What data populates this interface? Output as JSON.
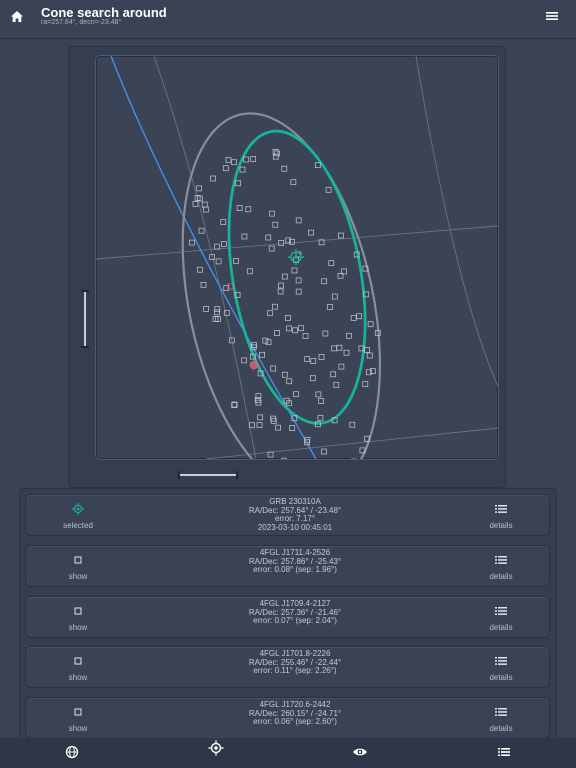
{
  "header": {
    "title": "Cone search around",
    "subtitle": "ra=257.64°, decn=-23.48°"
  },
  "colors": {
    "accent": "#16b39a",
    "selection_marker": "#e0667a",
    "galactic_line": "#4a8de0"
  },
  "sources": [
    {
      "action_icon": "target-icon",
      "action_label": "selected",
      "name": "GRB 230310A",
      "radec": "RA/Dec: 257.64° / -23.48°",
      "error": "error: 7.17°",
      "extra": "2023-03-10 00:45:01",
      "details_label": "details"
    },
    {
      "action_icon": "square-icon",
      "action_label": "show",
      "name": "4FGL J1711.4-2526",
      "radec": "RA/Dec: 257.86° / -25.43°",
      "error": "error: 0.08° (sep: 1.96°)",
      "extra": "",
      "details_label": "details"
    },
    {
      "action_icon": "square-icon",
      "action_label": "show",
      "name": "4FGL J1709.4-2127",
      "radec": "RA/Dec: 257.36° / -21.46°",
      "error": "error: 0.07° (sep: 2.04°)",
      "extra": "",
      "details_label": "details"
    },
    {
      "action_icon": "square-icon",
      "action_label": "show",
      "name": "4FGL J1701.8-2226",
      "radec": "RA/Dec: 255.46° / -22.44°",
      "error": "error: 0.11° (sep: 2.26°)",
      "extra": "",
      "details_label": "details"
    },
    {
      "action_icon": "square-icon",
      "action_label": "show",
      "name": "4FGL J1720.6-2442",
      "radec": "RA/Dec: 260.15° / -24.71°",
      "error": "error: 0.06° (sep: 2.60°)",
      "extra": "",
      "details_label": "details"
    }
  ],
  "bottom_nav": [
    {
      "icon": "globe-icon"
    },
    {
      "icon": "target-icon"
    },
    {
      "icon": "eye-icon"
    },
    {
      "icon": "list-icon"
    }
  ]
}
